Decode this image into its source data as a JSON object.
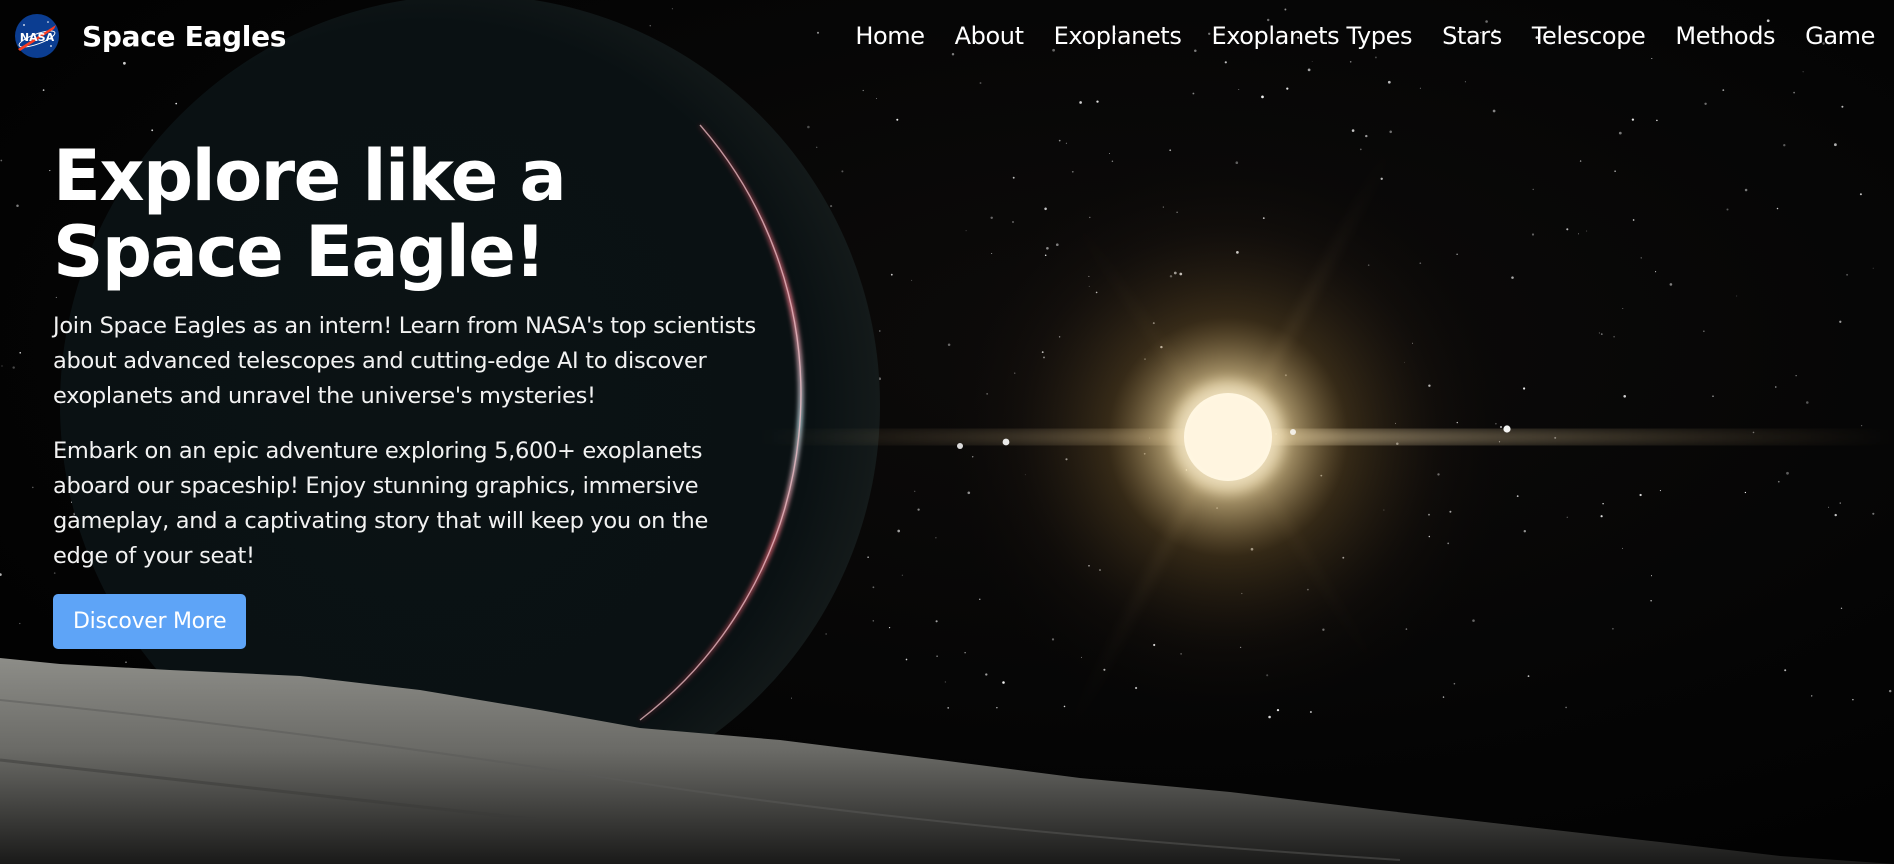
{
  "header": {
    "logo_icon": "nasa-meatball-logo",
    "brand_name": "Space Eagles",
    "nav": [
      {
        "label": "Home"
      },
      {
        "label": "About"
      },
      {
        "label": "Exoplanets"
      },
      {
        "label": "Exoplanets Types"
      },
      {
        "label": "Stars"
      },
      {
        "label": "Telescope"
      },
      {
        "label": "Methods"
      },
      {
        "label": "Game"
      }
    ]
  },
  "hero": {
    "title_line1": "Explore like a",
    "title_line2": "Space Eagle!",
    "paragraph1": "Join Space Eagles as an intern! Learn from NASA's top scientists about advanced telescopes and cutting-edge AI to discover exoplanets and unravel the universe's mysteries!",
    "paragraph2": "Embark on an epic adventure exploring 5,600+ exoplanets aboard our spaceship! Enjoy stunning graphics, immersive gameplay, and a captivating story that will keep you on the edge of your seat!",
    "cta_label": "Discover More"
  },
  "colors": {
    "button": "#5ea4f7",
    "background": "#000000",
    "text": "#ffffff",
    "sun_glow": "#f6dca0",
    "planet_rim": "#d94a5a"
  }
}
